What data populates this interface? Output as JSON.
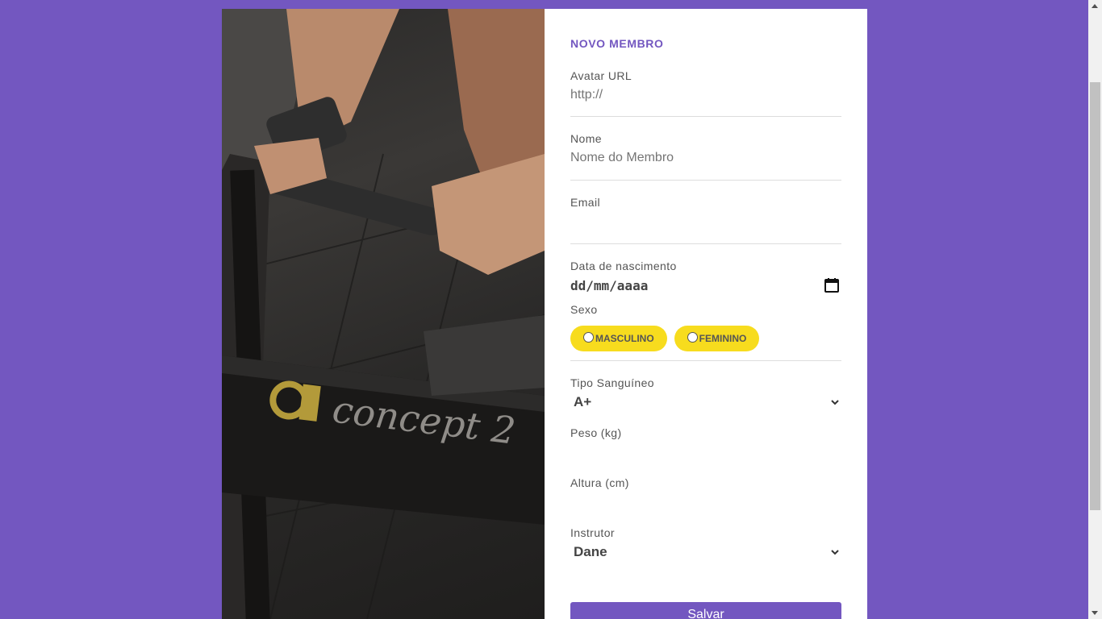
{
  "form": {
    "title": "NOVO MEMBRO",
    "avatar": {
      "label": "Avatar URL",
      "placeholder": "http://"
    },
    "nome": {
      "label": "Nome",
      "placeholder": "Nome do Membro"
    },
    "email": {
      "label": "Email",
      "value": ""
    },
    "nascimento": {
      "label": "Data de nascimento",
      "value": "dd/mm/aaaa"
    },
    "sexo": {
      "label": "Sexo",
      "options": [
        "MASCULINO",
        "FEMININO"
      ]
    },
    "tipo_sanguineo": {
      "label": "Tipo Sanguíneo",
      "value": "A+"
    },
    "peso": {
      "label": "Peso (kg)",
      "value": ""
    },
    "altura": {
      "label": "Altura (cm)",
      "value": ""
    },
    "instrutor": {
      "label": "Instrutor",
      "value": "Dane"
    },
    "save_label": "Salvar"
  },
  "photo": {
    "brand_text": "concept 2"
  },
  "colors": {
    "background": "#7357c0",
    "accent": "#7357c0",
    "pill": "#f7dc1e"
  },
  "icons": [
    "calendar-icon",
    "chevron-down-icon",
    "radio-icon"
  ]
}
